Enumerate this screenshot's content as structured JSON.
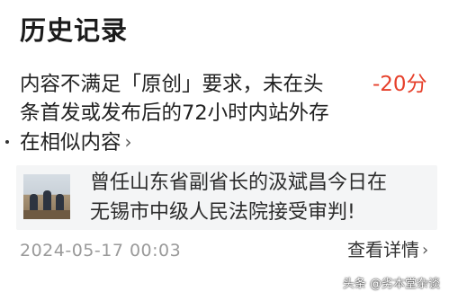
{
  "header": {
    "title": "历史记录"
  },
  "record": {
    "reason_lines": [
      "内容不满足「原创」要求，未在头",
      "条首发或发布后的72小时内站外存",
      "在相似内容"
    ],
    "reason_chevron": "›",
    "penalty": "-20分",
    "penalty_color": "#e6402b"
  },
  "article": {
    "title_lines": [
      "曾任山东省副省长的汲斌昌今日在",
      "无锡市中级人民法院接受审判!"
    ],
    "thumbnail_icon": "courtroom-photo"
  },
  "footer": {
    "timestamp": "2024-05-17 00:03",
    "details_label": "查看详情",
    "details_chevron": "›"
  },
  "watermark": {
    "text": "头条 @劣本堂杂谈"
  }
}
